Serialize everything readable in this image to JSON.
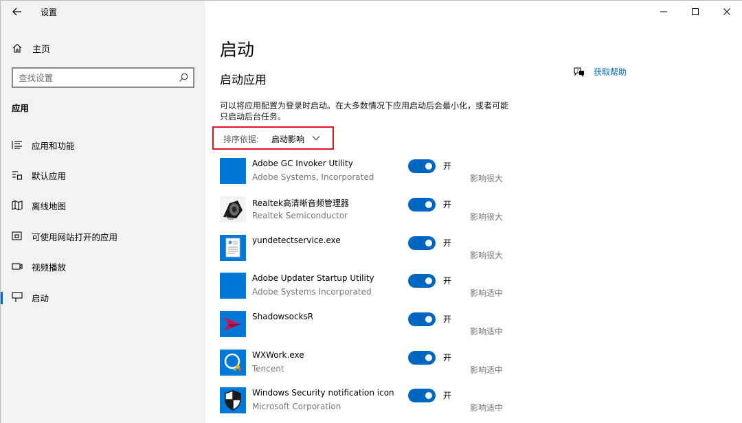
{
  "window": {
    "title": "设置"
  },
  "sidebar": {
    "home_label": "主页",
    "search_placeholder": "查找设置",
    "section_heading": "应用",
    "items": [
      {
        "label": "应用和功能",
        "icon": "apps-features-icon",
        "selected": false
      },
      {
        "label": "默认应用",
        "icon": "default-apps-icon",
        "selected": false
      },
      {
        "label": "离线地图",
        "icon": "offline-maps-icon",
        "selected": false
      },
      {
        "label": "可使用网站打开的应用",
        "icon": "apps-for-websites-icon",
        "selected": false
      },
      {
        "label": "视频播放",
        "icon": "video-playback-icon",
        "selected": false
      },
      {
        "label": "启动",
        "icon": "startup-icon",
        "selected": true
      }
    ]
  },
  "main": {
    "page_title": "启动",
    "section_title": "启动应用",
    "help_label": "获取帮助",
    "description": "可以将应用配置为登录时启动。在大多数情况下应用启动后会最小化，或者可能只启动后台任务。",
    "sort": {
      "label": "排序依据:",
      "value": "启动影响"
    },
    "apps": [
      {
        "name": "Adobe GC Invoker Utility",
        "publisher": "Adobe Systems, Incorporated",
        "state": "开",
        "on": true,
        "impact": "影响很大",
        "icon": "blank-tile-icon"
      },
      {
        "name": "Realtek高清晰音频管理器",
        "publisher": "Realtek Semiconductor",
        "state": "开",
        "on": true,
        "impact": "影响很大",
        "icon": "speaker-icon"
      },
      {
        "name": "yundetectservice.exe",
        "publisher": "",
        "state": "开",
        "on": true,
        "impact": "影响很大",
        "icon": "document-icon"
      },
      {
        "name": "Adobe Updater Startup Utility",
        "publisher": "Adobe Systems Incorporated",
        "state": "开",
        "on": true,
        "impact": "影响适中",
        "icon": "blank-tile-icon"
      },
      {
        "name": "ShadowsocksR",
        "publisher": "",
        "state": "开",
        "on": true,
        "impact": "影响适中",
        "icon": "paper-plane-icon"
      },
      {
        "name": "WXWork.exe",
        "publisher": "Tencent",
        "state": "开",
        "on": true,
        "impact": "影响适中",
        "icon": "wxwork-icon"
      },
      {
        "name": "Windows Security notification icon",
        "publisher": "Microsoft Corporation",
        "state": "开",
        "on": true,
        "impact": "影响适中",
        "icon": "shield-icon"
      }
    ]
  },
  "colors": {
    "accent": "#0067c0",
    "tile": "#0078d7",
    "sort_border": "#e81123"
  }
}
